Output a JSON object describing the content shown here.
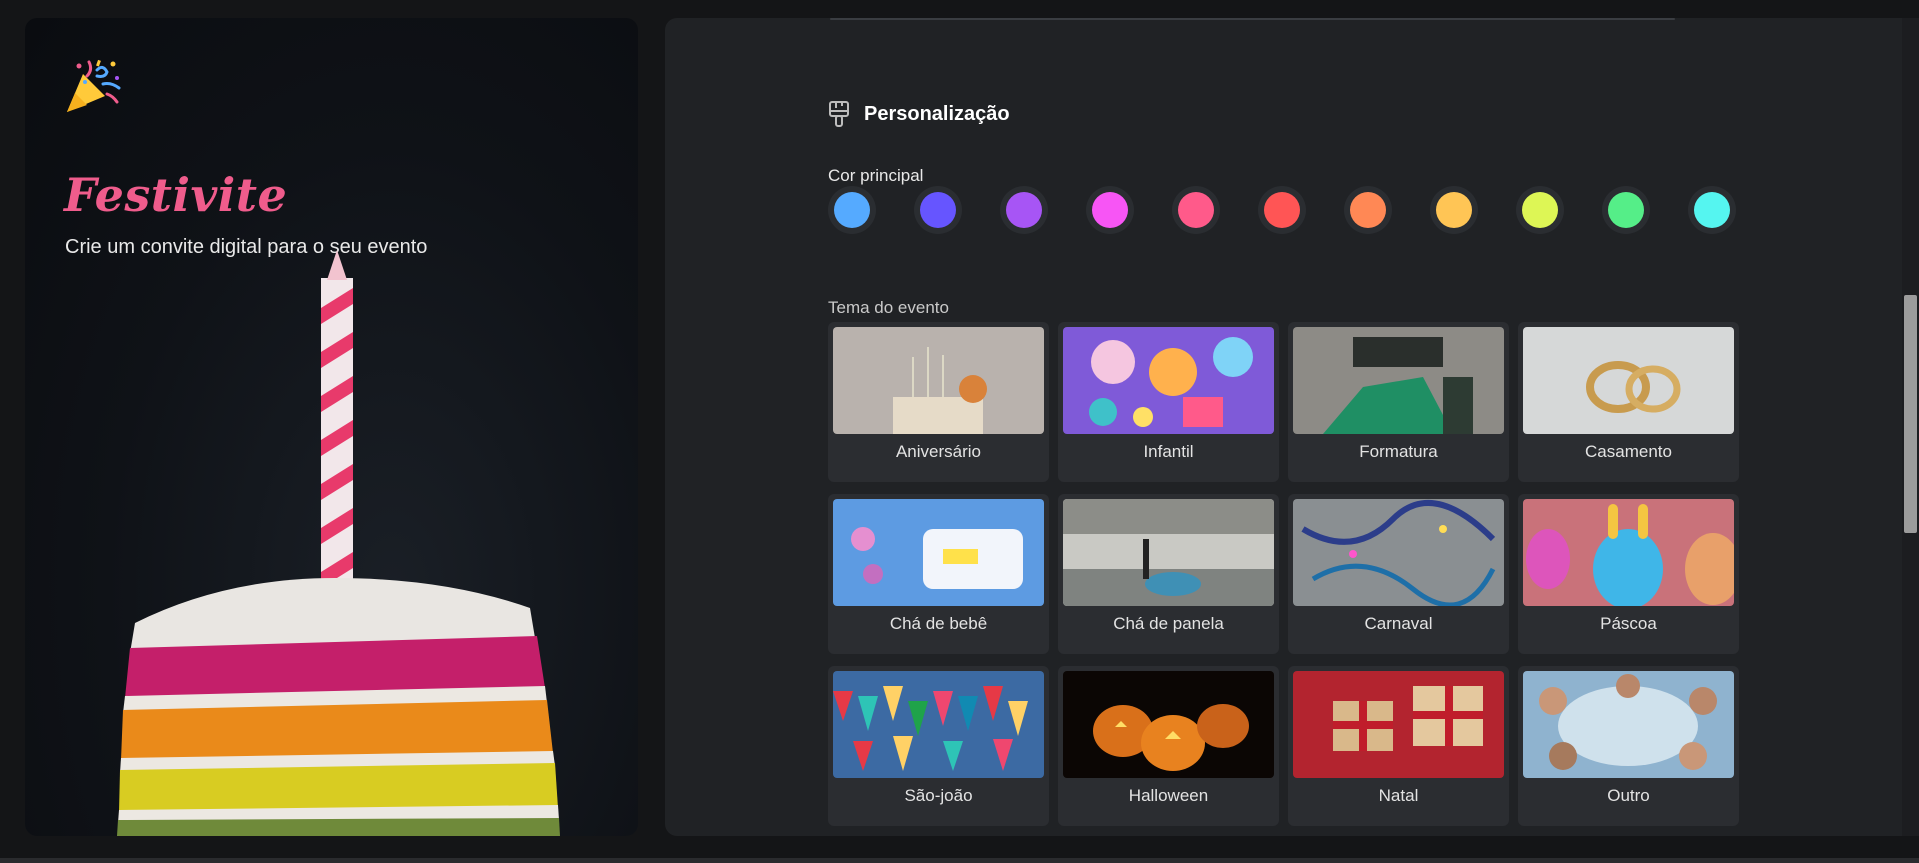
{
  "hero": {
    "brand": "Festivite",
    "tagline": "Crie um convite digital para o seu evento"
  },
  "personalization": {
    "title": "Personalização",
    "color_label": "Cor principal",
    "colors": [
      "#55aaff",
      "#6655ff",
      "#a755f5",
      "#f755f5",
      "#ff5a8a",
      "#ff5555",
      "#ff8855",
      "#ffc555",
      "#ddf655",
      "#55ee88",
      "#55f5f0"
    ],
    "theme_label": "Tema do evento",
    "themes": [
      {
        "label": "Aniversário"
      },
      {
        "label": "Infantil"
      },
      {
        "label": "Formatura"
      },
      {
        "label": "Casamento"
      },
      {
        "label": "Chá de bebê"
      },
      {
        "label": "Chá de panela"
      },
      {
        "label": "Carnaval"
      },
      {
        "label": "Páscoa"
      },
      {
        "label": "São-joão"
      },
      {
        "label": "Halloween"
      },
      {
        "label": "Natal"
      },
      {
        "label": "Outro"
      }
    ]
  }
}
